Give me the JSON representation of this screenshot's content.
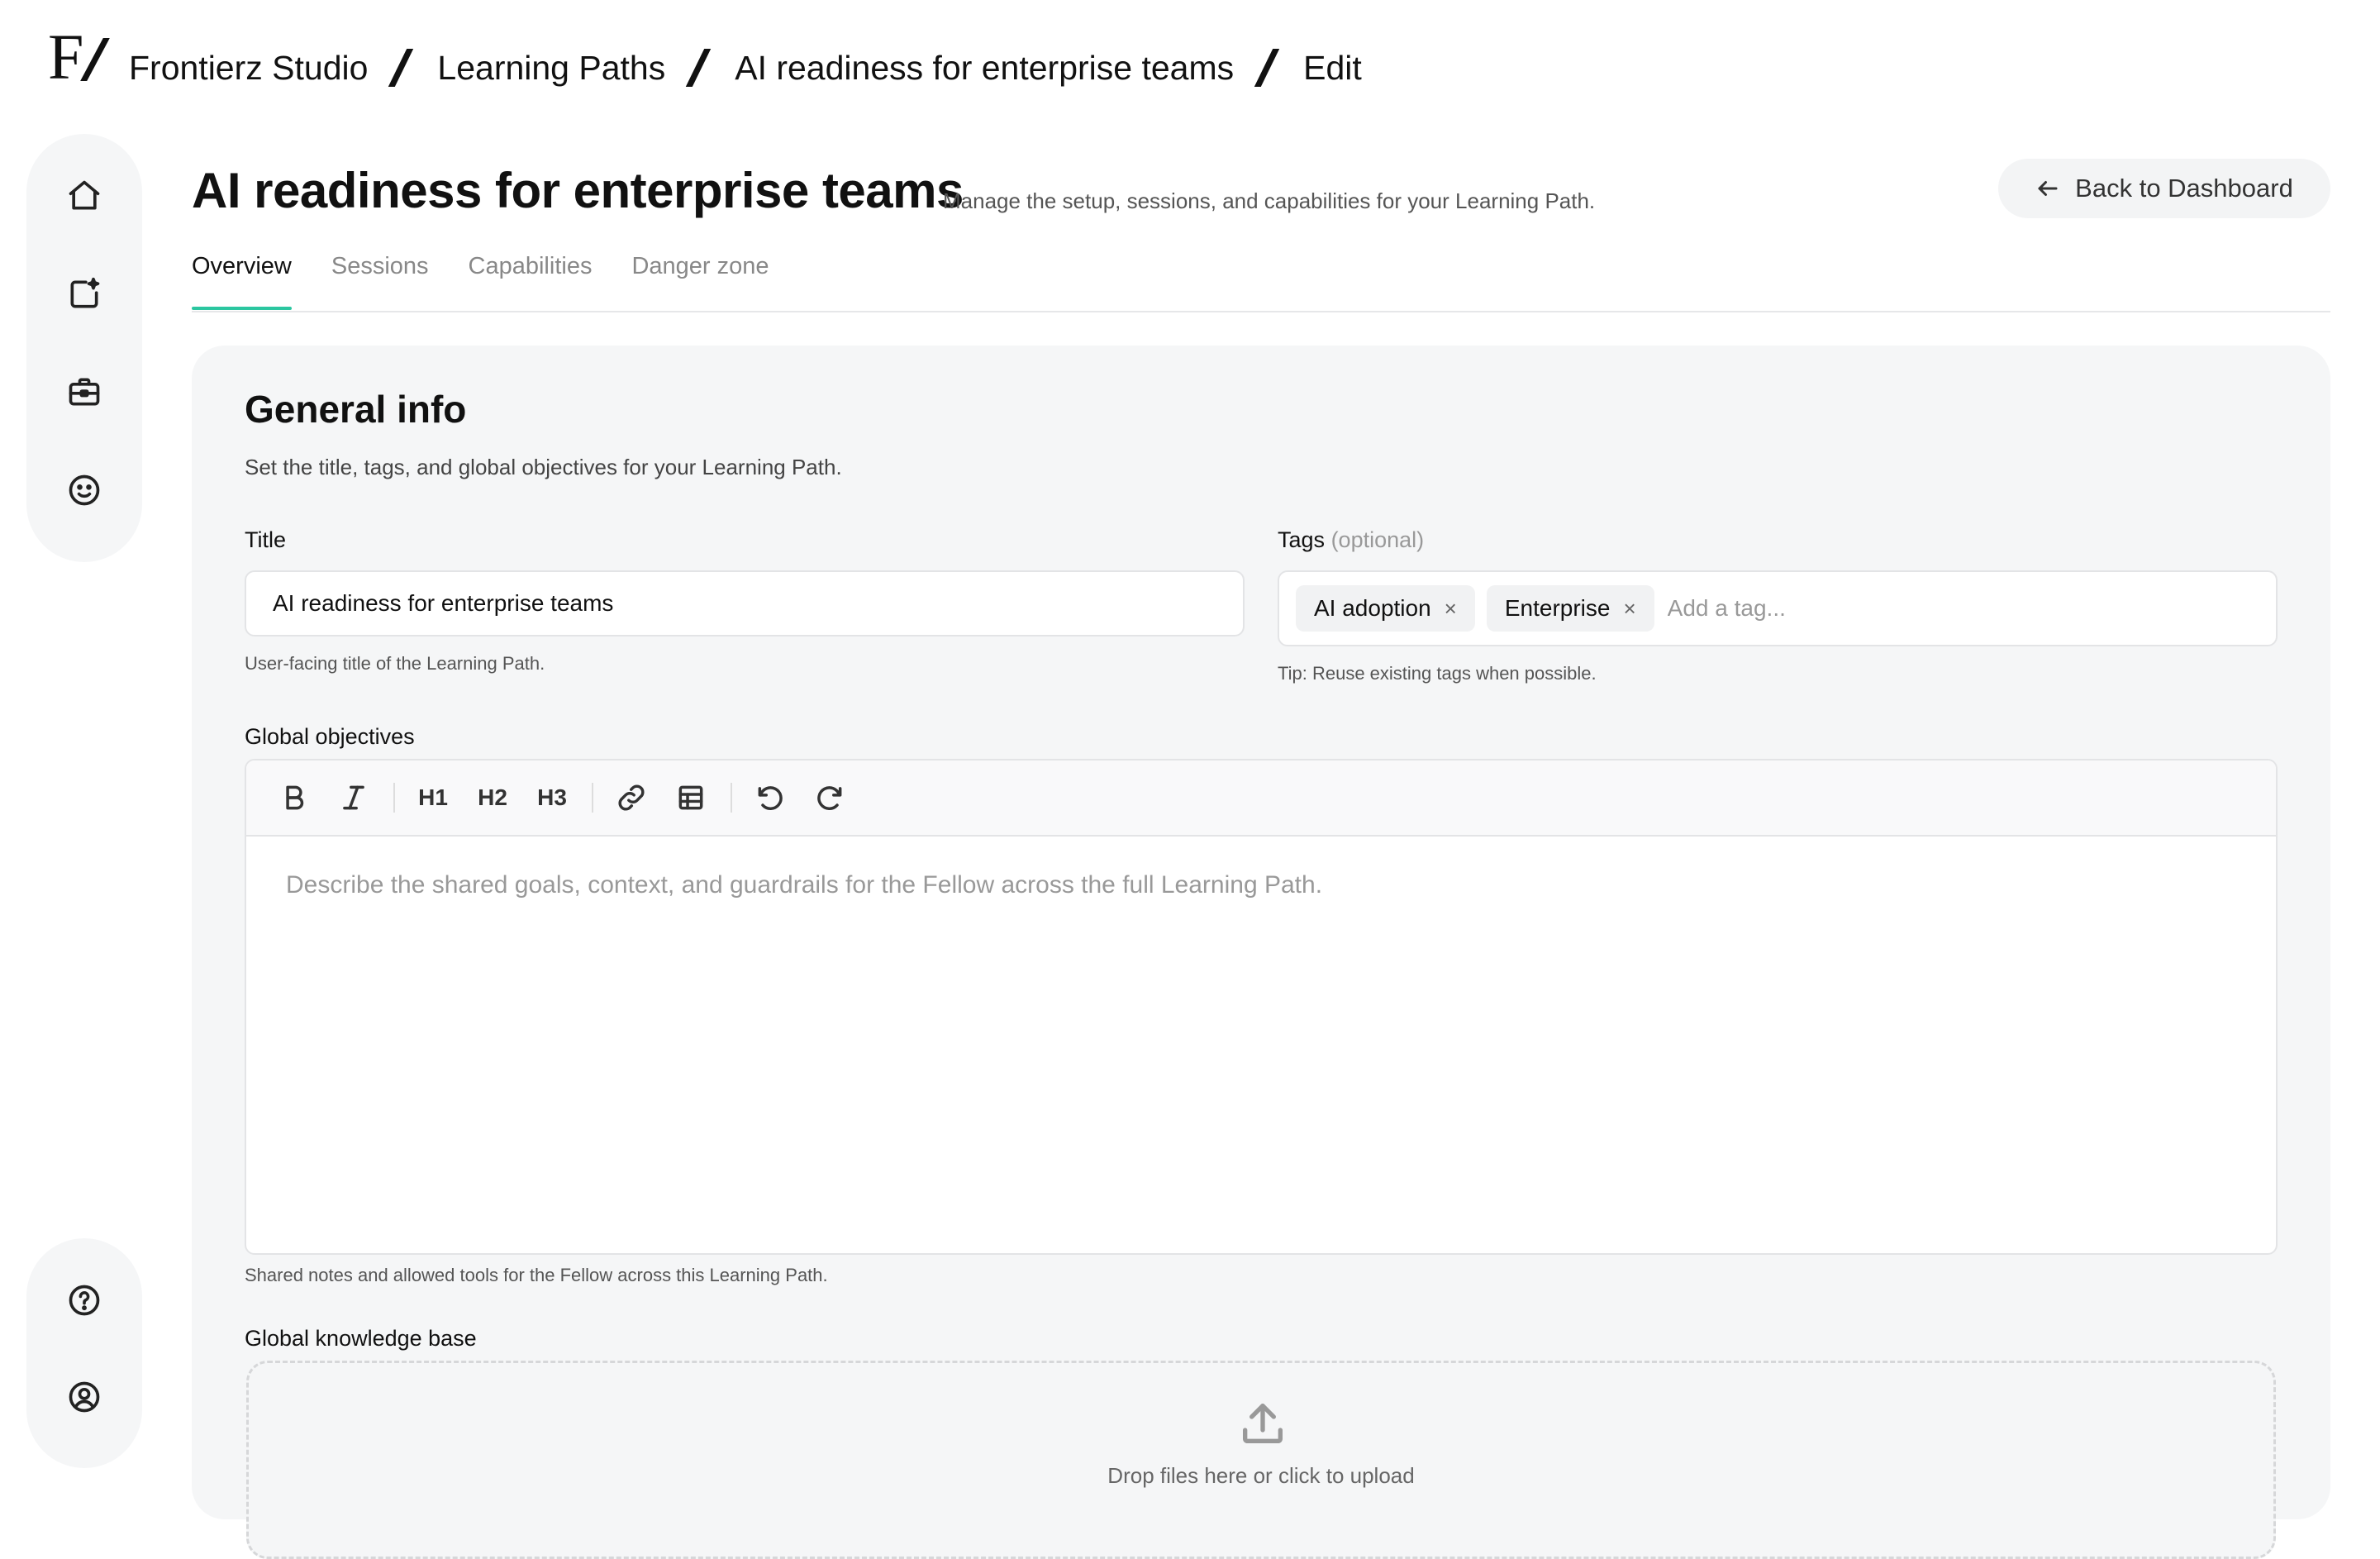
{
  "breadcrumb": {
    "logo_letter": "F",
    "items": [
      "Frontierz Studio",
      "Learning Paths",
      "AI readiness for enterprise teams",
      "Edit"
    ]
  },
  "sidebar": {
    "top_items": [
      {
        "icon": "home-icon"
      },
      {
        "icon": "new-document-icon"
      },
      {
        "icon": "briefcase-icon"
      },
      {
        "icon": "smiley-icon"
      }
    ],
    "bottom_items": [
      {
        "icon": "help-icon"
      },
      {
        "icon": "account-icon"
      }
    ]
  },
  "header": {
    "title": "AI readiness for enterprise teams",
    "subtitle": "Manage the setup, sessions, and capabilities for your Learning Path.",
    "back_label": "Back to Dashboard"
  },
  "tabs": [
    {
      "label": "Overview",
      "active": true
    },
    {
      "label": "Sessions",
      "active": false
    },
    {
      "label": "Capabilities",
      "active": false
    },
    {
      "label": "Danger zone",
      "active": false
    }
  ],
  "general_info": {
    "heading": "General info",
    "description": "Set the title, tags, and global objectives for your Learning Path.",
    "title_field": {
      "label": "Title",
      "value": "AI readiness for enterprise teams",
      "hint": "User-facing title of the Learning Path."
    },
    "tags_field": {
      "label": "Tags",
      "optional": "(optional)",
      "tags": [
        "AI adoption",
        "Enterprise"
      ],
      "remove_glyph": "×",
      "placeholder": "Add a tag...",
      "hint": "Tip: Reuse existing tags when possible."
    },
    "objectives": {
      "label": "Global objectives",
      "toolbar": {
        "h1": "H1",
        "h2": "H2",
        "h3": "H3"
      },
      "placeholder": "Describe the shared goals, context, and guardrails for the Fellow across the full Learning Path.",
      "hint": "Shared notes and allowed tools for the Fellow across this Learning Path."
    },
    "knowledge_base": {
      "label": "Global knowledge base",
      "drop_text": "Drop files here or click to upload"
    }
  },
  "colors": {
    "accent": "#2bc6a0",
    "panel": "#f5f6f7"
  }
}
